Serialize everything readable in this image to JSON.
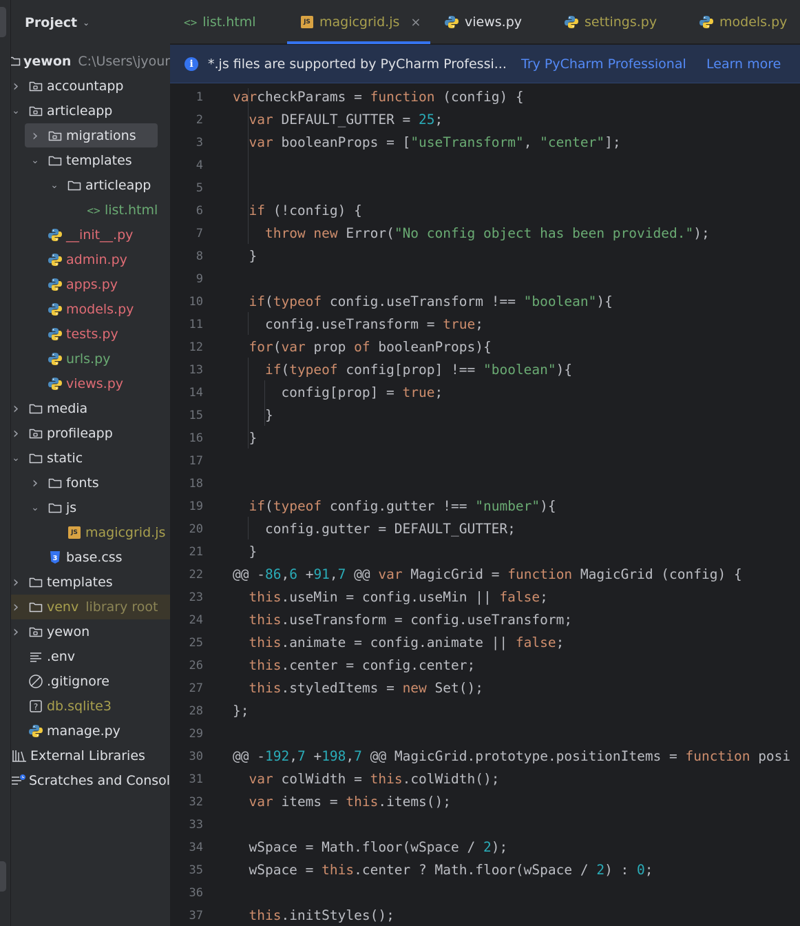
{
  "project_panel": {
    "title": "Project",
    "root": {
      "name": "yewon",
      "path": "C:\\Users\\jyour"
    },
    "items": [
      {
        "label": "accountapp"
      },
      {
        "label": "articleapp"
      },
      {
        "label": "migrations"
      },
      {
        "label": "templates"
      },
      {
        "label": "articleapp"
      },
      {
        "label": "list.html"
      },
      {
        "label": "__init__.py"
      },
      {
        "label": "admin.py"
      },
      {
        "label": "apps.py"
      },
      {
        "label": "models.py"
      },
      {
        "label": "tests.py"
      },
      {
        "label": "urls.py"
      },
      {
        "label": "views.py"
      },
      {
        "label": "media"
      },
      {
        "label": "profileapp"
      },
      {
        "label": "static"
      },
      {
        "label": "fonts"
      },
      {
        "label": "js"
      },
      {
        "label": "magicgrid.js"
      },
      {
        "label": "base.css"
      },
      {
        "label": "templates"
      },
      {
        "label": "venv",
        "hint": "library root"
      },
      {
        "label": "yewon"
      },
      {
        "label": ".env"
      },
      {
        "label": ".gitignore"
      },
      {
        "label": "db.sqlite3"
      },
      {
        "label": "manage.py"
      },
      {
        "label": "External Libraries"
      },
      {
        "label": "Scratches and Consoles"
      }
    ]
  },
  "tabs": [
    {
      "label": "list.html",
      "icon": "html-icon"
    },
    {
      "label": "magicgrid.js",
      "icon": "js-icon",
      "active": true,
      "close": "×"
    },
    {
      "label": "views.py",
      "icon": "python-icon"
    },
    {
      "label": "settings.py",
      "icon": "python-icon"
    },
    {
      "label": "models.py",
      "icon": "python-icon"
    }
  ],
  "banner": {
    "message": "*.js files are supported by PyCharm Professi...",
    "try_link": "Try PyCharm Professional",
    "learn_link": "Learn more"
  },
  "editor": {
    "line_numbers": [
      "1",
      "2",
      "3",
      "4",
      "5",
      "6",
      "7",
      "8",
      "9",
      "10",
      "11",
      "12",
      "13",
      "14",
      "15",
      "16",
      "17",
      "18",
      "19",
      "20",
      "21",
      "22",
      "23",
      "24",
      "25",
      "26",
      "27",
      "28",
      "29",
      "30",
      "31",
      "32",
      "33",
      "34",
      "35",
      "36",
      "37"
    ],
    "lines": [
      [
        [
          "k",
          "var"
        ],
        [
          "",
          "checkParams = "
        ],
        [
          "k",
          "function"
        ],
        [
          "",
          " (config) {"
        ]
      ],
      [
        [
          "",
          "  "
        ],
        [
          "k",
          "var"
        ],
        [
          "",
          " DEFAULT_GUTTER = "
        ],
        [
          "n",
          "25"
        ],
        [
          "",
          ";"
        ]
      ],
      [
        [
          "",
          "  "
        ],
        [
          "k",
          "var"
        ],
        [
          "",
          " booleanProps = ["
        ],
        [
          "s",
          "\"useTransform\""
        ],
        [
          "",
          ", "
        ],
        [
          "s",
          "\"center\""
        ],
        [
          "",
          "];"
        ]
      ],
      [],
      [],
      [
        [
          "",
          "  "
        ],
        [
          "k",
          "if"
        ],
        [
          "",
          " (!config) {"
        ]
      ],
      [
        [
          "",
          "    "
        ],
        [
          "k",
          "throw new"
        ],
        [
          "",
          " Error("
        ],
        [
          "s",
          "\"No config object has been provided.\""
        ],
        [
          "",
          ");"
        ]
      ],
      [
        [
          "",
          "  }"
        ]
      ],
      [],
      [
        [
          "",
          "  "
        ],
        [
          "k",
          "if"
        ],
        [
          "",
          "("
        ],
        [
          "k",
          "typeof"
        ],
        [
          "",
          " config.useTransform !== "
        ],
        [
          "s",
          "\"boolean\""
        ],
        [
          "",
          "){"
        ]
      ],
      [
        [
          "",
          "    config.useTransform = "
        ],
        [
          "k",
          "true"
        ],
        [
          "",
          ";"
        ]
      ],
      [
        [
          "",
          "  "
        ],
        [
          "k",
          "for"
        ],
        [
          "",
          "("
        ],
        [
          "k",
          "var"
        ],
        [
          "",
          " prop "
        ],
        [
          "k",
          "of"
        ],
        [
          "",
          " booleanProps){"
        ]
      ],
      [
        [
          "",
          "    "
        ],
        [
          "k",
          "if"
        ],
        [
          "",
          "("
        ],
        [
          "k",
          "typeof"
        ],
        [
          "",
          " config[prop] !== "
        ],
        [
          "s",
          "\"boolean\""
        ],
        [
          "",
          "){"
        ]
      ],
      [
        [
          "",
          "      config[prop] = "
        ],
        [
          "k",
          "true"
        ],
        [
          "",
          ";"
        ]
      ],
      [
        [
          "",
          "    }"
        ]
      ],
      [
        [
          "",
          "  }"
        ]
      ],
      [],
      [],
      [
        [
          "",
          "  "
        ],
        [
          "k",
          "if"
        ],
        [
          "",
          "("
        ],
        [
          "k",
          "typeof"
        ],
        [
          "",
          " config.gutter !== "
        ],
        [
          "s",
          "\"number\""
        ],
        [
          "",
          "){"
        ]
      ],
      [
        [
          "",
          "    config.gutter = DEFAULT_GUTTER;"
        ]
      ],
      [
        [
          "",
          "  }"
        ]
      ],
      [
        [
          "",
          "@@ -"
        ],
        [
          "n",
          "86"
        ],
        [
          "",
          ","
        ],
        [
          "n",
          "6"
        ],
        [
          "",
          " +"
        ],
        [
          "n",
          "91"
        ],
        [
          "",
          ","
        ],
        [
          "n",
          "7"
        ],
        [
          "",
          " @@ "
        ],
        [
          "k",
          "var"
        ],
        [
          "",
          " MagicGrid = "
        ],
        [
          "k",
          "function"
        ],
        [
          "",
          " MagicGrid (config) {"
        ]
      ],
      [
        [
          "",
          "  "
        ],
        [
          "k",
          "this"
        ],
        [
          "",
          ".useMin = config.useMin || "
        ],
        [
          "k",
          "false"
        ],
        [
          "",
          ";"
        ]
      ],
      [
        [
          "",
          "  "
        ],
        [
          "k",
          "this"
        ],
        [
          "",
          ".useTransform = config.useTransform;"
        ]
      ],
      [
        [
          "",
          "  "
        ],
        [
          "k",
          "this"
        ],
        [
          "",
          ".animate = config.animate || "
        ],
        [
          "k",
          "false"
        ],
        [
          "",
          ";"
        ]
      ],
      [
        [
          "",
          "  "
        ],
        [
          "k",
          "this"
        ],
        [
          "",
          ".center = config.center;"
        ]
      ],
      [
        [
          "",
          "  "
        ],
        [
          "k",
          "this"
        ],
        [
          "",
          ".styledItems = "
        ],
        [
          "k",
          "new"
        ],
        [
          "",
          " Set();"
        ]
      ],
      [
        [
          "",
          "};"
        ]
      ],
      [],
      [
        [
          "",
          "@@ -"
        ],
        [
          "n",
          "192"
        ],
        [
          "",
          ","
        ],
        [
          "n",
          "7"
        ],
        [
          "",
          " +"
        ],
        [
          "n",
          "198"
        ],
        [
          "",
          ","
        ],
        [
          "n",
          "7"
        ],
        [
          "",
          " @@ MagicGrid.prototype.positionItems = "
        ],
        [
          "k",
          "function"
        ],
        [
          "",
          " posi"
        ]
      ],
      [
        [
          "",
          "  "
        ],
        [
          "k",
          "var"
        ],
        [
          "",
          " colWidth = "
        ],
        [
          "k",
          "this"
        ],
        [
          "",
          ".colWidth();"
        ]
      ],
      [
        [
          "",
          "  "
        ],
        [
          "k",
          "var"
        ],
        [
          "",
          " items = "
        ],
        [
          "k",
          "this"
        ],
        [
          "",
          ".items();"
        ]
      ],
      [],
      [
        [
          "",
          "  wSpace = Math.floor(wSpace / "
        ],
        [
          "n",
          "2"
        ],
        [
          "",
          ");"
        ]
      ],
      [
        [
          "",
          "  wSpace = "
        ],
        [
          "k",
          "this"
        ],
        [
          "",
          ".center ? Math.floor(wSpace / "
        ],
        [
          "n",
          "2"
        ],
        [
          "",
          ") : "
        ],
        [
          "n",
          "0"
        ],
        [
          "",
          ";"
        ]
      ],
      [],
      [
        [
          "",
          "  "
        ],
        [
          "k",
          "this"
        ],
        [
          "",
          ".initStyles();"
        ]
      ]
    ]
  }
}
